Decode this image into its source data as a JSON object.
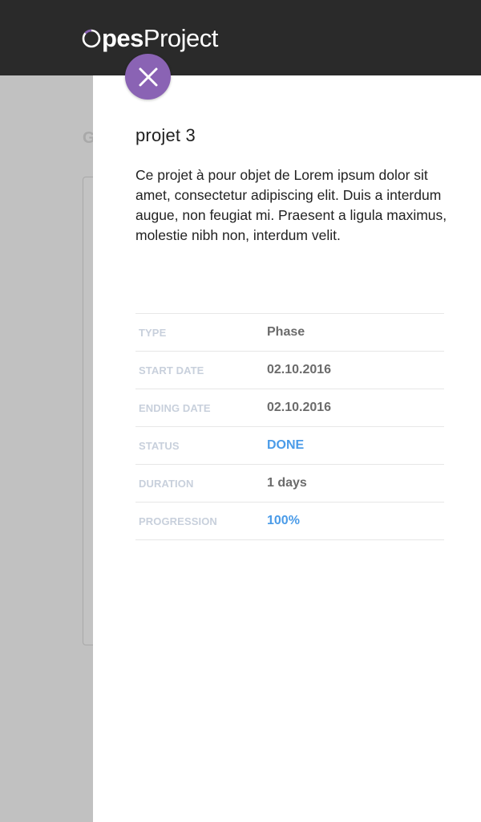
{
  "header": {
    "logo_bold": "pes",
    "logo_light": "Project"
  },
  "background": {
    "heading_fragment": "G"
  },
  "panel": {
    "close_icon": "close-icon",
    "title": "projet 3",
    "description": "Ce projet à pour objet de Lorem ipsum dolor sit amet, consectetur adipiscing elit. Duis a interdum augue, non feugiat mi. Praesent a ligula maximus, molestie nibh non, interdum velit.",
    "details": [
      {
        "label": "TYPE",
        "value": "Phase"
      },
      {
        "label": "START DATE",
        "value": "02.10.2016"
      },
      {
        "label": "ENDING DATE",
        "value": "02.10.2016"
      },
      {
        "label": "STATUS",
        "value": "DONE"
      },
      {
        "label": "DURATION",
        "value": "1 days"
      },
      {
        "label": "PROGRESSION",
        "value": "100%"
      }
    ]
  },
  "colors": {
    "topbar": "#2a2a2a",
    "overlay": "#c1c1c1",
    "close_button": "#8a63b4",
    "accent_value": "#4a9be8",
    "label": "#c8d0dc"
  }
}
